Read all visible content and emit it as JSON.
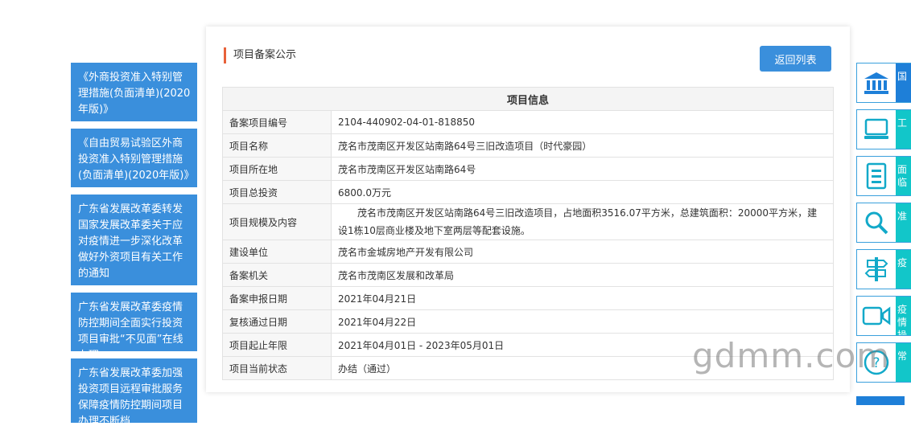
{
  "left_links": [
    "《外商投资准入特别管理措施(负面清单)(2020年版)》",
    "《自由贸易试验区外商投资准入特别管理措施(负面清单)(2020年版)》",
    "广东省发展改革委转发国家发展改革委关于应对疫情进一步深化改革做好外资项目有关工作的通知",
    "广东省发展改革委疫情防控期间全面实行投资项目审批“不见面”在线办理",
    "广东省发展改革委加强投资项目远程审批服务保障疫情防控期间项目办理不断档"
  ],
  "panel": {
    "title": "项目备案公示",
    "back_label": "返回列表",
    "table_header": "项目信息",
    "rows": [
      {
        "label": "备案项目编号",
        "value": "2104-440902-04-01-818850"
      },
      {
        "label": "项目名称",
        "value": "茂名市茂南区开发区站南路64号三旧改造项目（时代豪园）"
      },
      {
        "label": "项目所在地",
        "value": "茂名市茂南区开发区站南路64号"
      },
      {
        "label": "项目总投资",
        "value": "6800.0万元"
      },
      {
        "label": "项目规模及内容",
        "value": "茂名市茂南区开发区站南路64号三旧改造项目，占地面积3516.07平方米，总建筑面积：20000平方米，建设1栋10层商业楼及地下室两层等配套设施。"
      },
      {
        "label": "建设单位",
        "value": "茂名市金城房地产开发有限公司"
      },
      {
        "label": "备案机关",
        "value": "茂名市茂南区发展和改革局"
      },
      {
        "label": "备案申报日期",
        "value": "2021年04月21日"
      },
      {
        "label": "复核通过日期",
        "value": "2021年04月22日"
      },
      {
        "label": "项目起止年限",
        "value": "2021年04月01日 - 2023年05月01日"
      },
      {
        "label": "项目当前状态",
        "value": "办结（通过）"
      }
    ]
  },
  "right_buttons": [
    {
      "icon": "bank-icon",
      "text": "国"
    },
    {
      "icon": "monitor-icon",
      "text": "工"
    },
    {
      "icon": "document-icon",
      "text": "面临"
    },
    {
      "icon": "search-icon",
      "text": "准"
    },
    {
      "icon": "signpost-icon",
      "text": "疫"
    },
    {
      "icon": "video-icon",
      "text": "疫情操"
    },
    {
      "icon": "question-icon",
      "text": "常"
    }
  ],
  "watermark": "gdmm.com",
  "colors": {
    "accent": "#3a8fdc",
    "teal": "#12c6c9",
    "title_bar": "#e8623a"
  }
}
